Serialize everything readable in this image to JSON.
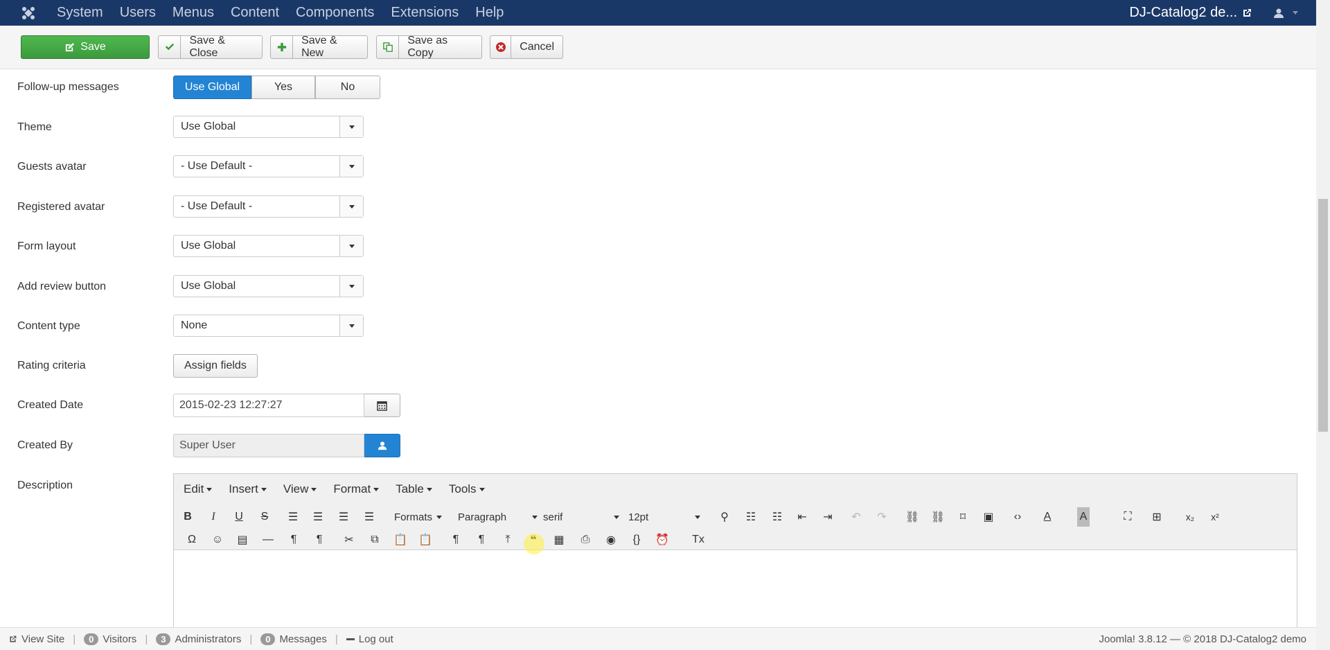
{
  "navbar": {
    "menu": [
      "System",
      "Users",
      "Menus",
      "Content",
      "Components",
      "Extensions",
      "Help"
    ],
    "site_name": "DJ-Catalog2 de..."
  },
  "toolbar": {
    "save": "Save",
    "save_close": "Save & Close",
    "save_new": "Save & New",
    "save_copy": "Save as Copy",
    "cancel": "Cancel"
  },
  "form": {
    "followup": {
      "label": "Follow-up messages",
      "options": [
        "Use Global",
        "Yes",
        "No"
      ],
      "active": "Use Global"
    },
    "theme": {
      "label": "Theme",
      "value": "Use Global"
    },
    "guests_avatar": {
      "label": "Guests avatar",
      "value": "- Use Default -"
    },
    "registered_avatar": {
      "label": "Registered avatar",
      "value": "- Use Default -"
    },
    "form_layout": {
      "label": "Form layout",
      "value": "Use Global"
    },
    "add_review": {
      "label": "Add review button",
      "value": "Use Global"
    },
    "content_type": {
      "label": "Content type",
      "value": "None"
    },
    "rating": {
      "label": "Rating criteria",
      "button": "Assign fields"
    },
    "created_date": {
      "label": "Created Date",
      "value": "2015-02-23 12:27:27"
    },
    "created_by": {
      "label": "Created By",
      "value": "Super User"
    },
    "description": {
      "label": "Description"
    }
  },
  "editor": {
    "menus": [
      "Edit",
      "Insert",
      "View",
      "Format",
      "Table",
      "Tools"
    ],
    "formats": "Formats",
    "block": "Paragraph",
    "font": "serif",
    "size": "12pt"
  },
  "status": {
    "view_site": "View Site",
    "visitors_count": "0",
    "visitors": "Visitors",
    "admins_count": "3",
    "admins": "Administrators",
    "messages_count": "0",
    "messages": "Messages",
    "logout": "Log out",
    "copyright": "Joomla! 3.8.12 — © 2018 DJ-Catalog2 demo"
  }
}
